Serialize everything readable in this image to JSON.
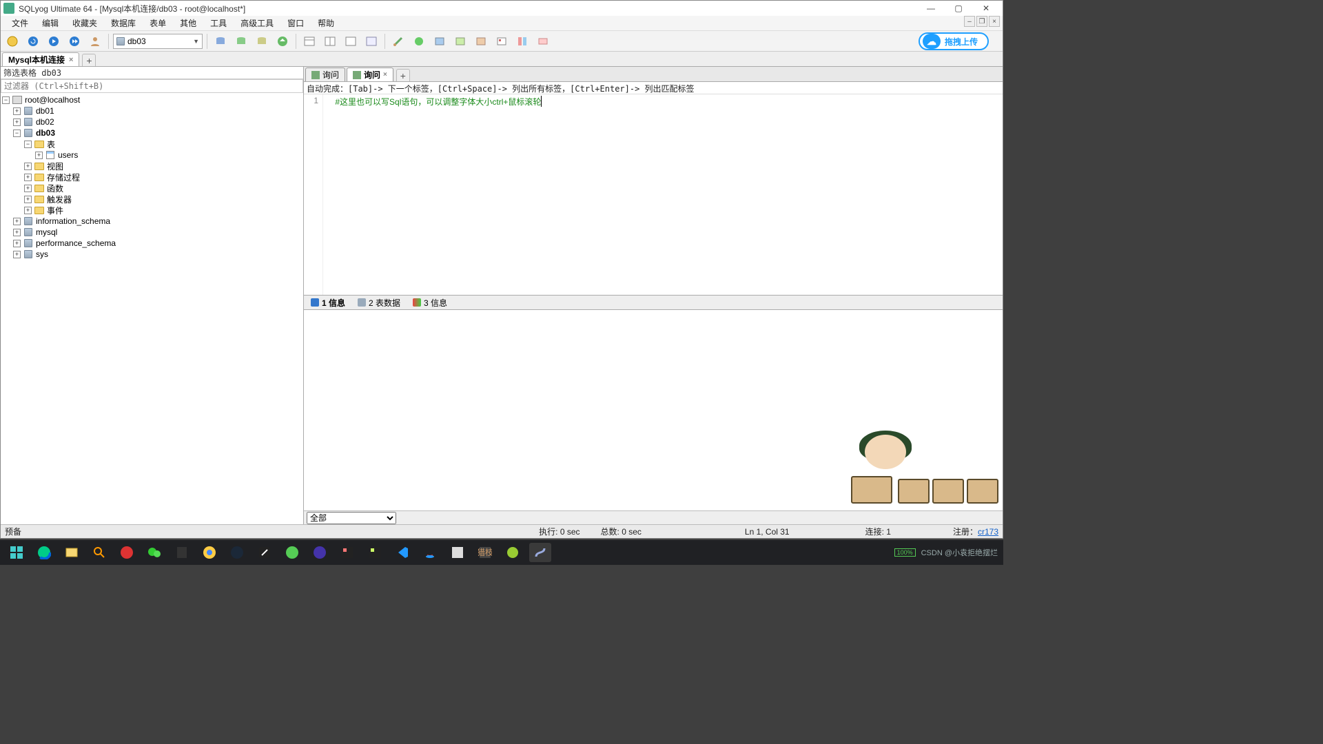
{
  "title": "SQLyog Ultimate 64 - [Mysql本机连接/db03 - root@localhost*]",
  "menus": [
    "文件",
    "编辑",
    "收藏夹",
    "数据库",
    "表单",
    "其他",
    "工具",
    "高级工具",
    "窗口",
    "帮助"
  ],
  "upload_label": "拖拽上传",
  "db_dropdown": "db03",
  "conn_tab": "Mysql本机连接",
  "filter_label": "筛选表格 db03",
  "filter_placeholder": "过滤器 (Ctrl+Shift+B)",
  "tree": {
    "root": "root@localhost",
    "dbs": [
      "db01",
      "db02"
    ],
    "db03": {
      "name": "db03",
      "tables_label": "表",
      "tables": [
        "users"
      ],
      "folders": [
        "视图",
        "存储过程",
        "函数",
        "触发器",
        "事件"
      ]
    },
    "rest": [
      "information_schema",
      "mysql",
      "performance_schema",
      "sys"
    ]
  },
  "query_tabs": {
    "t1": "询问",
    "t2": "询问"
  },
  "hint": "自动完成：[Tab]-> 下一个标签，[Ctrl+Space]-> 列出所有标签，[Ctrl+Enter]-> 列出匹配标签",
  "code_line_no": "1",
  "code_line": "#这里也可以写Sql语句，可以调整字体大小ctrl+鼠标滚轮",
  "result_tabs": {
    "t1": "1 信息",
    "t2": "2 表数据",
    "t3": "3 信息"
  },
  "result_footer_option": "全部",
  "status": {
    "ready": "预备",
    "exec": "执行: 0 sec",
    "total": "总数: 0 sec",
    "pos": "Ln 1, Col 31",
    "conn": "连接: 1",
    "reg_label": "注册：",
    "reg_link": "cr173"
  },
  "watermark": "CSDN @小袁拒绝摆烂",
  "battery": "100%"
}
